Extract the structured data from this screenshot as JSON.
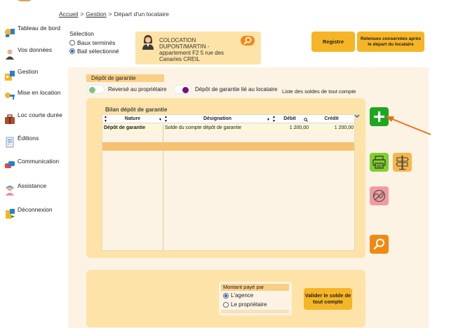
{
  "breadcrumb": {
    "home": "Accueil",
    "sep1": ">",
    "section": "Gestion",
    "sep2": ">",
    "current": "Départ d'un locataire"
  },
  "sidebar": {
    "items": [
      {
        "label": "Tableau de bord",
        "icon": "dashboard-icon"
      },
      {
        "label": "Vos données",
        "icon": "user-icon"
      },
      {
        "label": "Gestion",
        "icon": "gestion-icon"
      },
      {
        "label": "Mise en location",
        "icon": "key-icon"
      },
      {
        "label": "Loc courte durée",
        "icon": "suitcase-icon"
      },
      {
        "label": "Éditions",
        "icon": "document-icon"
      },
      {
        "label": "Communication",
        "icon": "chat-icon"
      },
      {
        "label": "Assistance",
        "icon": "support-icon"
      },
      {
        "label": "Déconnexion",
        "icon": "logout-icon"
      }
    ]
  },
  "selection": {
    "title": "Sélection",
    "options": [
      {
        "label": "Baux terminés",
        "checked": false
      },
      {
        "label": "Bail sélectionné",
        "checked": true
      }
    ]
  },
  "location_card": {
    "line1": "COLOCATION",
    "line2": "DUPONT/MARTIN -",
    "line3": "appartement F2 5 rue des",
    "line4": "Canaries CREIL"
  },
  "buttons": {
    "registre": "Registre",
    "retenues": "Retenues conservées après le départ du locataire",
    "valider": "Valider le solde de tout compte"
  },
  "depot": {
    "label": "Dépôt de garantie",
    "toggle_left": "Reversé au propriétaire",
    "toggle_right": "Dépôt de garantie lié au locataire",
    "liste_link": "Liste des soldes de tout compte"
  },
  "bilan": {
    "title": "Bilan dépôt de garantie",
    "columns": [
      "Nature",
      "Désignation",
      "Débit",
      "Crédit"
    ],
    "rows": [
      {
        "nature": "Dépôt de garantie",
        "designation": "Solde du compte dépôt de garantie",
        "debit": "1 200,00",
        "credit": "1 200,00"
      }
    ]
  },
  "montant": {
    "title": "Montant payé par",
    "options": [
      {
        "label": "L'agence",
        "checked": true
      },
      {
        "label": "Le propriétaire",
        "checked": false
      }
    ]
  },
  "colors": {
    "accent_orange": "#f6b526",
    "panel_bg": "#fdf3e5",
    "card_bg": "#fde3a7",
    "add_green": "#1fa61f",
    "arrow": "#ef6b1b"
  }
}
